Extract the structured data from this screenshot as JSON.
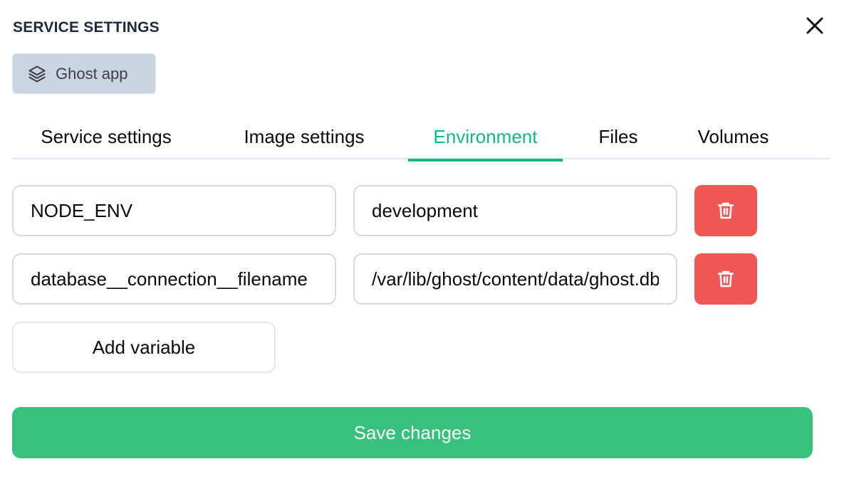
{
  "dialog": {
    "title": "SERVICE SETTINGS",
    "close_icon": "close-icon",
    "service_badge": {
      "icon": "layers-icon",
      "label": "Ghost app"
    }
  },
  "tabs": [
    {
      "label": "Service settings",
      "active": false
    },
    {
      "label": "Image settings",
      "active": false
    },
    {
      "label": "Environment",
      "active": true
    },
    {
      "label": "Files",
      "active": false
    },
    {
      "label": "Volumes",
      "active": false
    }
  ],
  "environment": {
    "variables": [
      {
        "key": "NODE_ENV",
        "value": "development",
        "delete_icon": "trash-icon"
      },
      {
        "key": "database__connection__filename",
        "value": "/var/lib/ghost/content/data/ghost.db",
        "delete_icon": "trash-icon"
      }
    ],
    "add_button_label": "Add variable"
  },
  "footer": {
    "save_button_label": "Save changes"
  },
  "colors": {
    "accent": "#10b981",
    "save_button": "#38c07d",
    "delete_button": "#ef5757",
    "badge_bg": "#cbd5e1",
    "title_text": "#1e293b"
  }
}
